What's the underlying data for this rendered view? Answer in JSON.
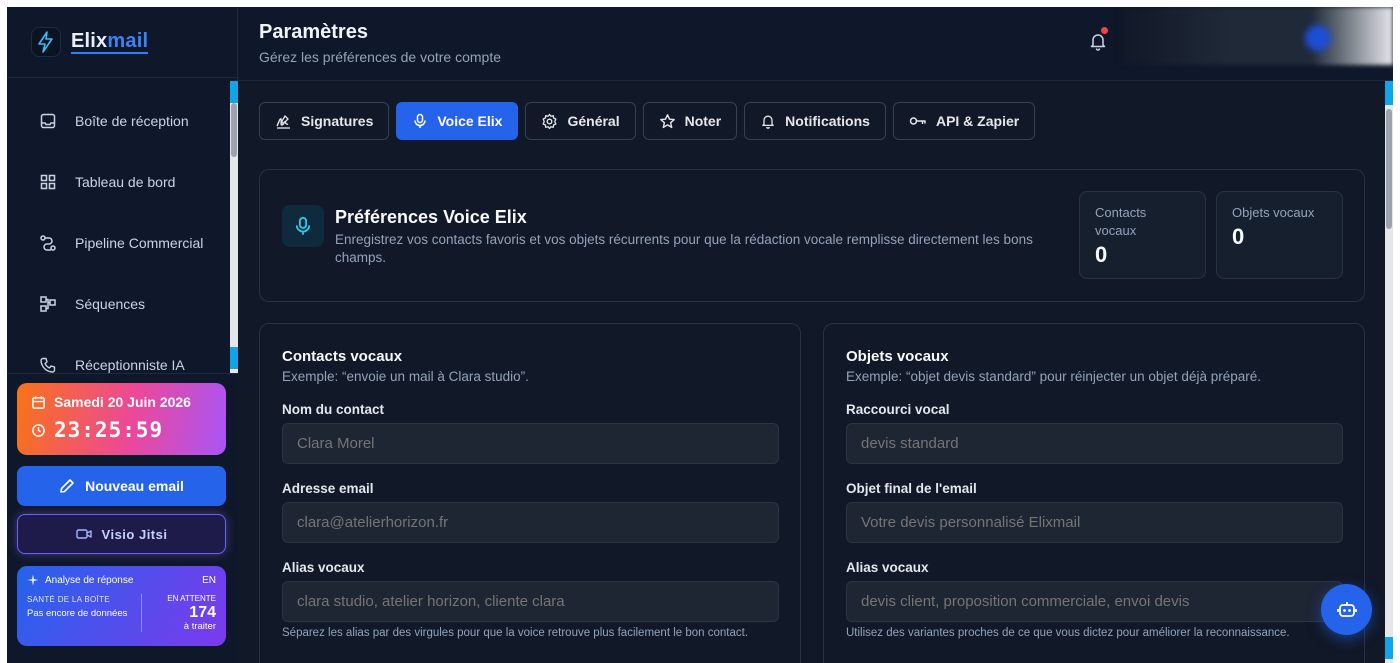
{
  "brand": {
    "name_a": "Elix",
    "name_b": "mail"
  },
  "header": {
    "title": "Paramètres",
    "subtitle": "Gérez les préférences de votre compte"
  },
  "sidebar": {
    "items": [
      {
        "label": "Boîte de réception",
        "icon": "inbox-icon"
      },
      {
        "label": "Tableau de bord",
        "icon": "dashboard-icon"
      },
      {
        "label": "Pipeline Commercial",
        "icon": "pipeline-icon"
      },
      {
        "label": "Séquences",
        "icon": "sequences-icon"
      },
      {
        "label": "Réceptionniste IA",
        "icon": "phone-icon"
      }
    ],
    "date": "Samedi 20 Juin 2026",
    "time": "23:25:59",
    "new_email": "Nouveau email",
    "visio": "Visio Jitsi",
    "analysis": {
      "title": "Analyse de réponse",
      "lang": "EN",
      "health_caption": "SANTÉ DE LA BOÎTE",
      "health_value": "Pas encore de données",
      "pending_caption": "EN ATTENTE",
      "pending_count": "174",
      "pending_sub": "à traiter"
    }
  },
  "tabs": [
    {
      "label": "Signatures",
      "icon": "signature-icon",
      "active": false
    },
    {
      "label": "Voice Elix",
      "icon": "mic-icon",
      "active": true
    },
    {
      "label": "Général",
      "icon": "gear-icon",
      "active": false
    },
    {
      "label": "Noter",
      "icon": "star-icon",
      "active": false
    },
    {
      "label": "Notifications",
      "icon": "bell-icon",
      "active": false
    },
    {
      "label": "API & Zapier",
      "icon": "key-icon",
      "active": false
    }
  ],
  "prefs": {
    "title": "Préférences Voice Elix",
    "description": "Enregistrez vos contacts favoris et vos objets récurrents pour que la rédaction vocale remplisse directement les bons champs.",
    "stats": [
      {
        "label": "Contacts vocaux",
        "value": "0"
      },
      {
        "label": "Objets vocaux",
        "value": "0"
      }
    ]
  },
  "contacts": {
    "title": "Contacts vocaux",
    "example": "Exemple: “envoie un mail à Clara studio”.",
    "fields": [
      {
        "label": "Nom du contact",
        "placeholder": "Clara Morel"
      },
      {
        "label": "Adresse email",
        "placeholder": "clara@atelierhorizon.fr"
      },
      {
        "label": "Alias vocaux",
        "placeholder": "clara studio, atelier horizon, cliente clara"
      }
    ],
    "hint": "Séparez les alias par des virgules pour que la voice retrouve plus facilement le bon contact."
  },
  "objects": {
    "title": "Objets vocaux",
    "example": "Exemple: “objet devis standard” pour réinjecter un objet déjà préparé.",
    "fields": [
      {
        "label": "Raccourci vocal",
        "placeholder": "devis standard"
      },
      {
        "label": "Objet final de l'email",
        "placeholder": "Votre devis personnalisé Elixmail"
      },
      {
        "label": "Alias vocaux",
        "placeholder": "devis client, proposition commerciale, envoi devis"
      }
    ],
    "hint": "Utilisez des variantes proches de ce que vous dictez pour améliorer la reconnaissance."
  },
  "colors": {
    "accent": "#2563eb",
    "background": "#111827",
    "sidebar": "#0f172a",
    "notification_dot": "#ef4444"
  }
}
